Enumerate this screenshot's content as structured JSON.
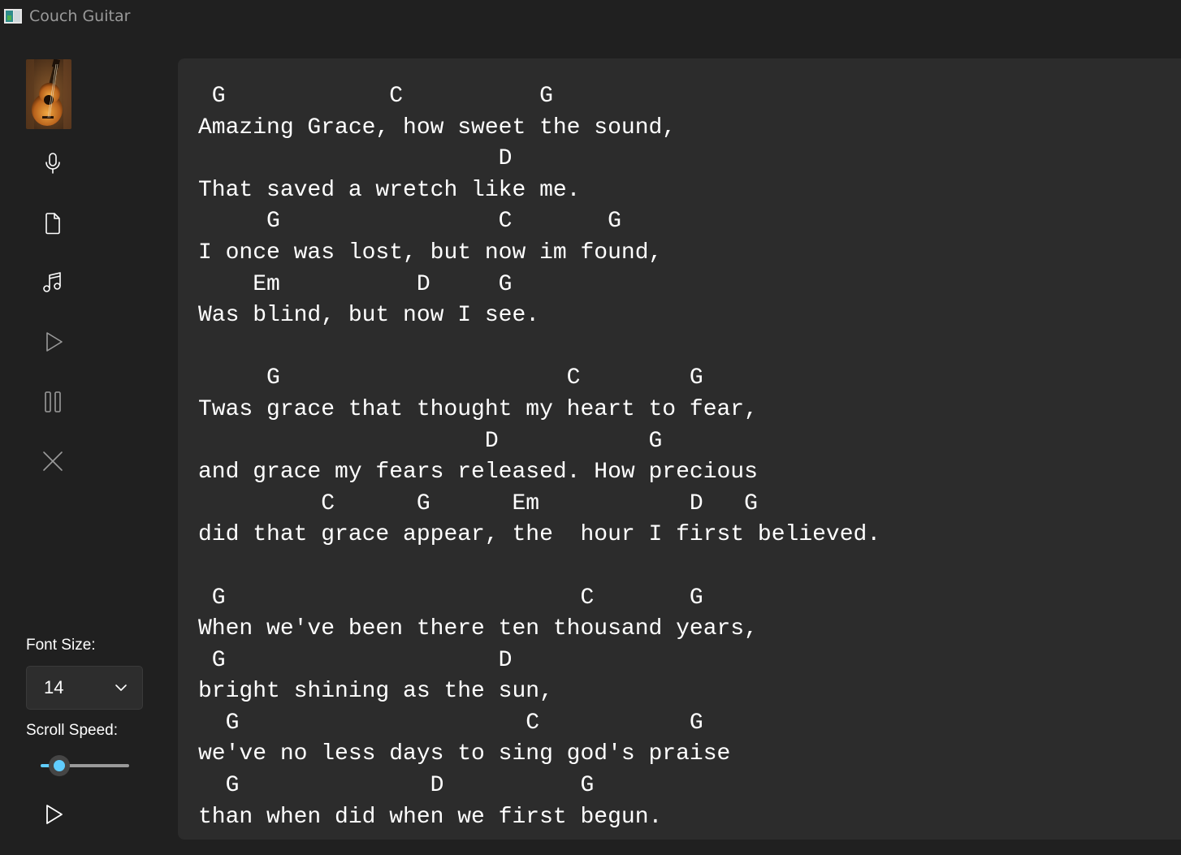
{
  "window": {
    "title": "Couch Guitar"
  },
  "sidebar": {
    "album_art": "guitar-thumbnail",
    "nav": [
      {
        "icon": "microphone-icon"
      },
      {
        "icon": "document-icon"
      },
      {
        "icon": "music-note-icon"
      },
      {
        "icon": "play-icon"
      },
      {
        "icon": "pause-icon"
      },
      {
        "icon": "close-icon"
      }
    ],
    "font_size_label": "Font Size:",
    "font_size_value": "14",
    "scroll_speed_label": "Scroll Speed:",
    "scroll_speed_level": 0.2,
    "play_icon": "play-icon"
  },
  "colors": {
    "background": "#202020",
    "panel": "#2c2c2c",
    "accent": "#60cdff",
    "text": "#ffffff"
  },
  "sheet": {
    "lines": [
      " G            C          G",
      "Amazing Grace, how sweet the sound,",
      "                      D",
      "That saved a wretch like me.",
      "     G                C       G",
      "I once was lost, but now im found,",
      "    Em          D     G",
      "Was blind, but now I see.",
      "",
      "     G                     C        G",
      "Twas grace that thought my heart to fear,",
      "                     D           G",
      "and grace my fears released. How precious",
      "         C      G      Em           D   G",
      "did that grace appear, the  hour I first believed.",
      "",
      " G                          C       G",
      "When we've been there ten thousand years,",
      " G                    D",
      "bright shining as the sun,",
      "  G                     C           G",
      "we've no less days to sing god's praise",
      "  G              D          G",
      "than when did when we first begun."
    ]
  }
}
